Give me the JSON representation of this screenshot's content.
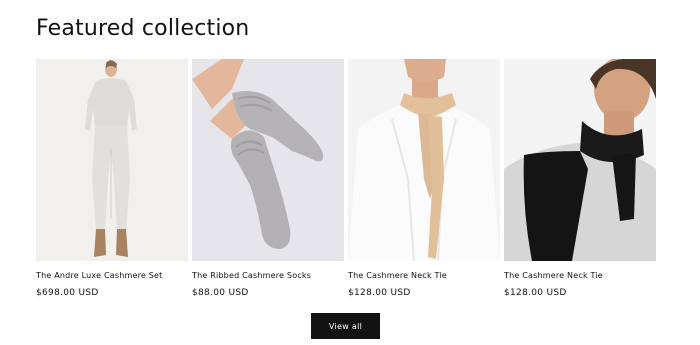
{
  "section": {
    "heading": "Featured collection"
  },
  "products": [
    {
      "title": "The Andre Luxe Cashmere Set",
      "price": "$698.00 USD"
    },
    {
      "title": "The Ribbed Cashmere Socks",
      "price": "$88.00 USD"
    },
    {
      "title": "The Cashmere Neck Tie",
      "price": "$128.00 USD"
    },
    {
      "title": "The Cashmere Neck Tie",
      "price": "$128.00 USD"
    }
  ],
  "view_all": {
    "label": "View all"
  }
}
